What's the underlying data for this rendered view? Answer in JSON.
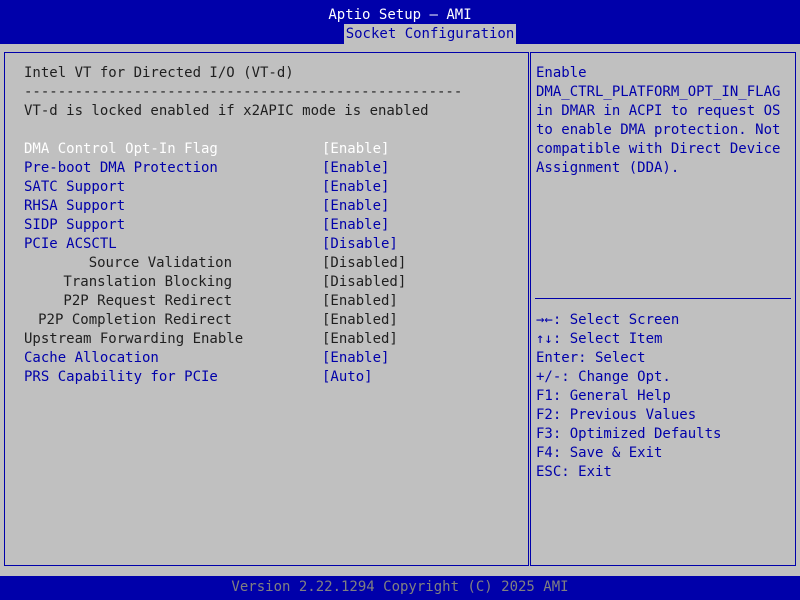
{
  "header": {
    "title": "Aptio Setup – AMI",
    "active_tab": "Socket Configuration"
  },
  "section": {
    "title": "Intel VT for Directed I/O (VT-d)",
    "separator": "----------------------------------------------------",
    "note": "VT-d is locked enabled if x2APIC mode is enabled"
  },
  "settings": [
    {
      "label": "DMA Control Opt-In Flag",
      "value": "[Enable]"
    },
    {
      "label": "Pre-boot DMA Protection",
      "value": "[Enable]"
    },
    {
      "label": "SATC Support",
      "value": "[Enable]"
    },
    {
      "label": "RHSA Support",
      "value": "[Enable]"
    },
    {
      "label": "SIDP Support",
      "value": "[Enable]"
    },
    {
      "label": "PCIe ACSCTL",
      "value": "[Disable]"
    },
    {
      "label": "Source Validation",
      "value": "[Disabled]"
    },
    {
      "label": "Translation Blocking",
      "value": "[Disabled]"
    },
    {
      "label": "P2P Request Redirect",
      "value": "[Enabled]"
    },
    {
      "label": "P2P Completion Redirect",
      "value": "[Enabled]"
    },
    {
      "label": "Upstream Forwarding Enable",
      "value": "[Enabled]"
    },
    {
      "label": "Cache Allocation",
      "value": "[Enable]"
    },
    {
      "label": "PRS Capability for PCIe",
      "value": "[Auto]"
    }
  ],
  "help": {
    "description": [
      "Enable",
      "DMA_CTRL_PLATFORM_OPT_IN_FLAG",
      "in DMAR in ACPI to request OS",
      "to enable DMA protection. Not",
      "compatible with Direct Device",
      "Assignment (DDA)."
    ],
    "keys": [
      "→←: Select Screen",
      "↑↓: Select Item",
      "Enter: Select",
      "+/-: Change Opt.",
      "F1: General Help",
      "F2: Previous Values",
      "F3: Optimized Defaults",
      "F4: Save & Exit",
      "ESC: Exit"
    ]
  },
  "footer": {
    "version": "Version 2.22.1294 Copyright (C) 2025 AMI"
  },
  "colors": {
    "background_blue": "#0000aa",
    "panel_gray": "#c0c0c0",
    "highlight_white": "#ffffff",
    "footer_text": "#808080"
  }
}
